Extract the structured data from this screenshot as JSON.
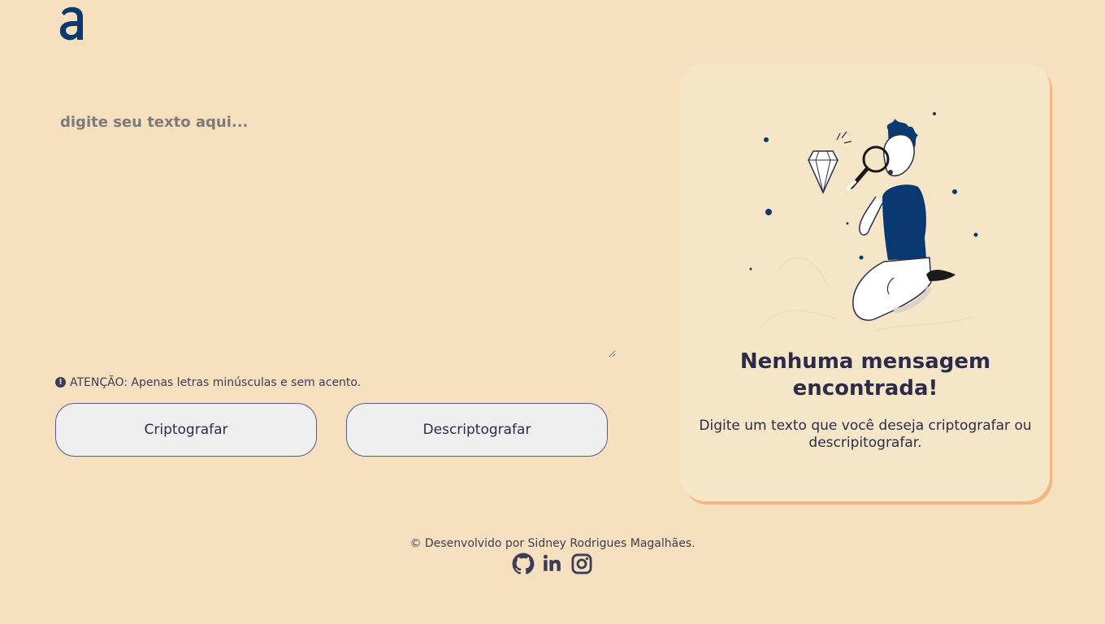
{
  "brand": {
    "logo_icon": "alura-a-logo-icon",
    "color": "#0a3871"
  },
  "input": {
    "placeholder": "digite seu texto aqui...",
    "value": ""
  },
  "warning": {
    "icon": "exclamation-circle-icon",
    "text": "ATENÇÃO: Apenas letras minúsculas e sem acento."
  },
  "actions": {
    "encrypt_label": "Criptografar",
    "decrypt_label": "Descriptografar"
  },
  "output": {
    "illustration": "person-with-magnifying-glass-and-diamond",
    "title": "Nenhuma mensagem encontrada!",
    "text": "Digite um texto que você deseja criptografar ou descripitografar."
  },
  "footer": {
    "credit": "© Desenvolvido por Sidney Rodrigues Magalhães.",
    "social": [
      "github-icon",
      "linkedin-icon",
      "instagram-icon"
    ]
  },
  "colors": {
    "background": "#f6e0c0",
    "card": "#f5e6c8",
    "card_shadow": "#f5b57e",
    "accent": "#0a3871"
  }
}
